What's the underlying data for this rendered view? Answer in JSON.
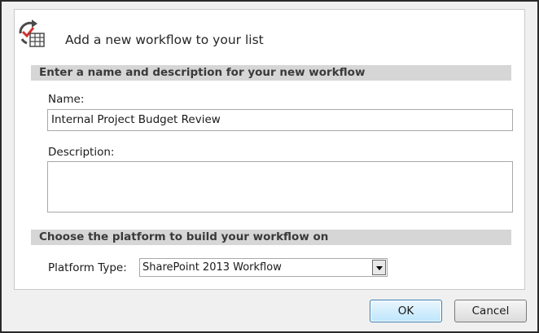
{
  "dialog": {
    "title": "Add a new workflow to your list",
    "header_icon": "workflow-list-icon",
    "section_name_heading": "Enter a name and description for your new workflow",
    "name_label": "Name:",
    "name_value": "Internal Project Budget Review",
    "description_label": "Description:",
    "description_value": "",
    "section_platform_heading": "Choose the platform to build your workflow on",
    "platform_label": "Platform Type:",
    "platform_selected": "SharePoint 2013 Workflow",
    "ok_label": "OK",
    "cancel_label": "Cancel"
  },
  "colors": {
    "section_background": "#d6d6d6",
    "ok_border": "#3c7fb1",
    "dialog_background": "#f0f0f0",
    "check_red": "#d0312d"
  }
}
